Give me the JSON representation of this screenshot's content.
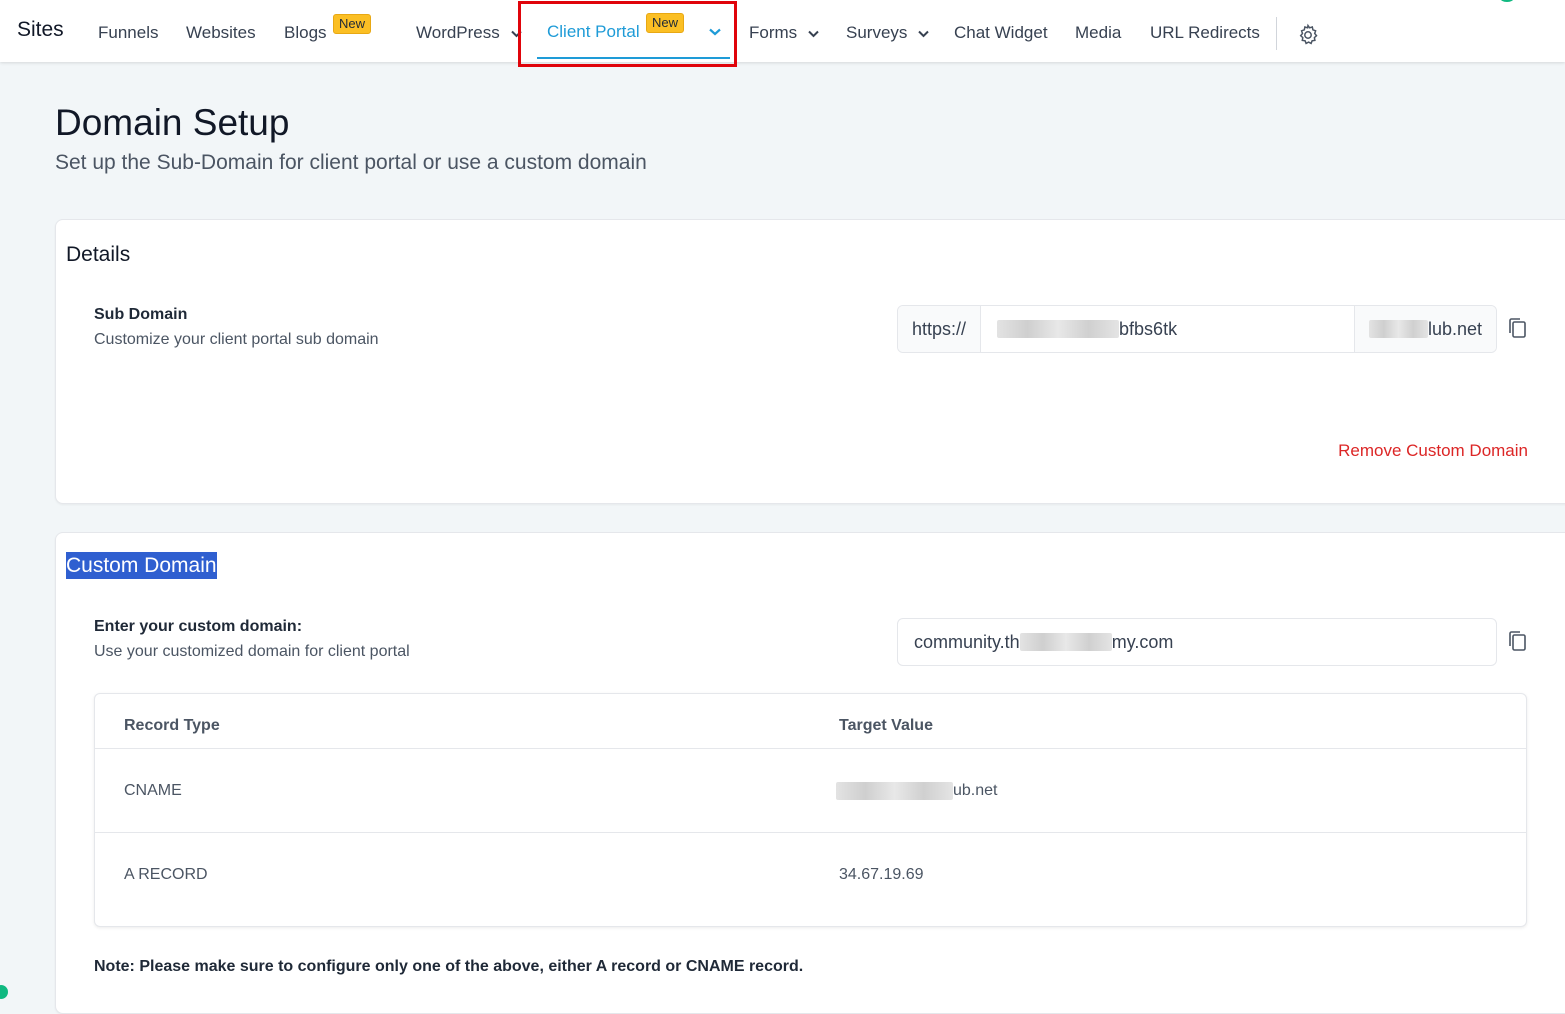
{
  "nav": {
    "brand": "Sites",
    "items": [
      "Funnels",
      "Websites",
      "Blogs",
      "WordPress",
      "Client Portal",
      "Forms",
      "Surveys",
      "Chat Widget",
      "Media",
      "URL Redirects"
    ],
    "new_badge": "New",
    "active_item": "Client Portal",
    "active_color": "#1e9bd7",
    "settings_icon": "gear-icon"
  },
  "page": {
    "title": "Domain Setup",
    "subtitle": "Set up the Sub-Domain for client portal or use a custom domain"
  },
  "details": {
    "title": "Details",
    "sub_domain_label": "Sub Domain",
    "sub_domain_help": "Customize your client portal sub domain",
    "prefix": "https://",
    "sub_domain_value": "bfbs6tk",
    "suffix_value": "lub.net",
    "remove_link": "Remove Custom Domain",
    "remove_color": "#dc2626"
  },
  "custom_domain": {
    "title": "Custom Domain",
    "label": "Enter your custom domain:",
    "help": "Use your customized domain for client portal",
    "value_start": "community.th",
    "value_end": "my.com",
    "table": {
      "headers": [
        "Record Type",
        "Target Value"
      ],
      "rows": [
        {
          "type": "CNAME",
          "value": "ub.net"
        },
        {
          "type": "A RECORD",
          "value": "34.67.19.69"
        }
      ]
    },
    "note": "Note: Please make sure to configure only one of the above, either A record or CNAME record."
  }
}
